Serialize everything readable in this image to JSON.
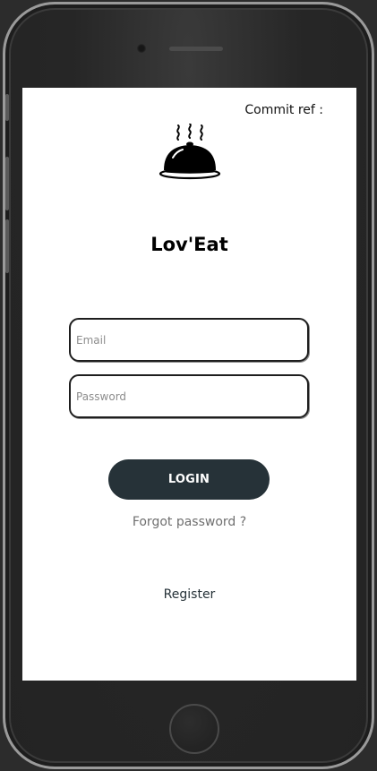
{
  "header": {
    "commit_ref_label": "Commit ref :"
  },
  "brand": {
    "logo_icon": "cloche-icon",
    "app_name": "Lov'Eat"
  },
  "form": {
    "email_placeholder": "Email",
    "email_value": "",
    "password_placeholder": "Password",
    "password_value": "",
    "login_label": "LOGIN",
    "forgot_label": "Forgot password ?",
    "register_label": "Register"
  },
  "colors": {
    "primary": "#263238",
    "background": "#ffffff",
    "device_frame": "#262626",
    "muted_text": "#6f6f6f"
  }
}
